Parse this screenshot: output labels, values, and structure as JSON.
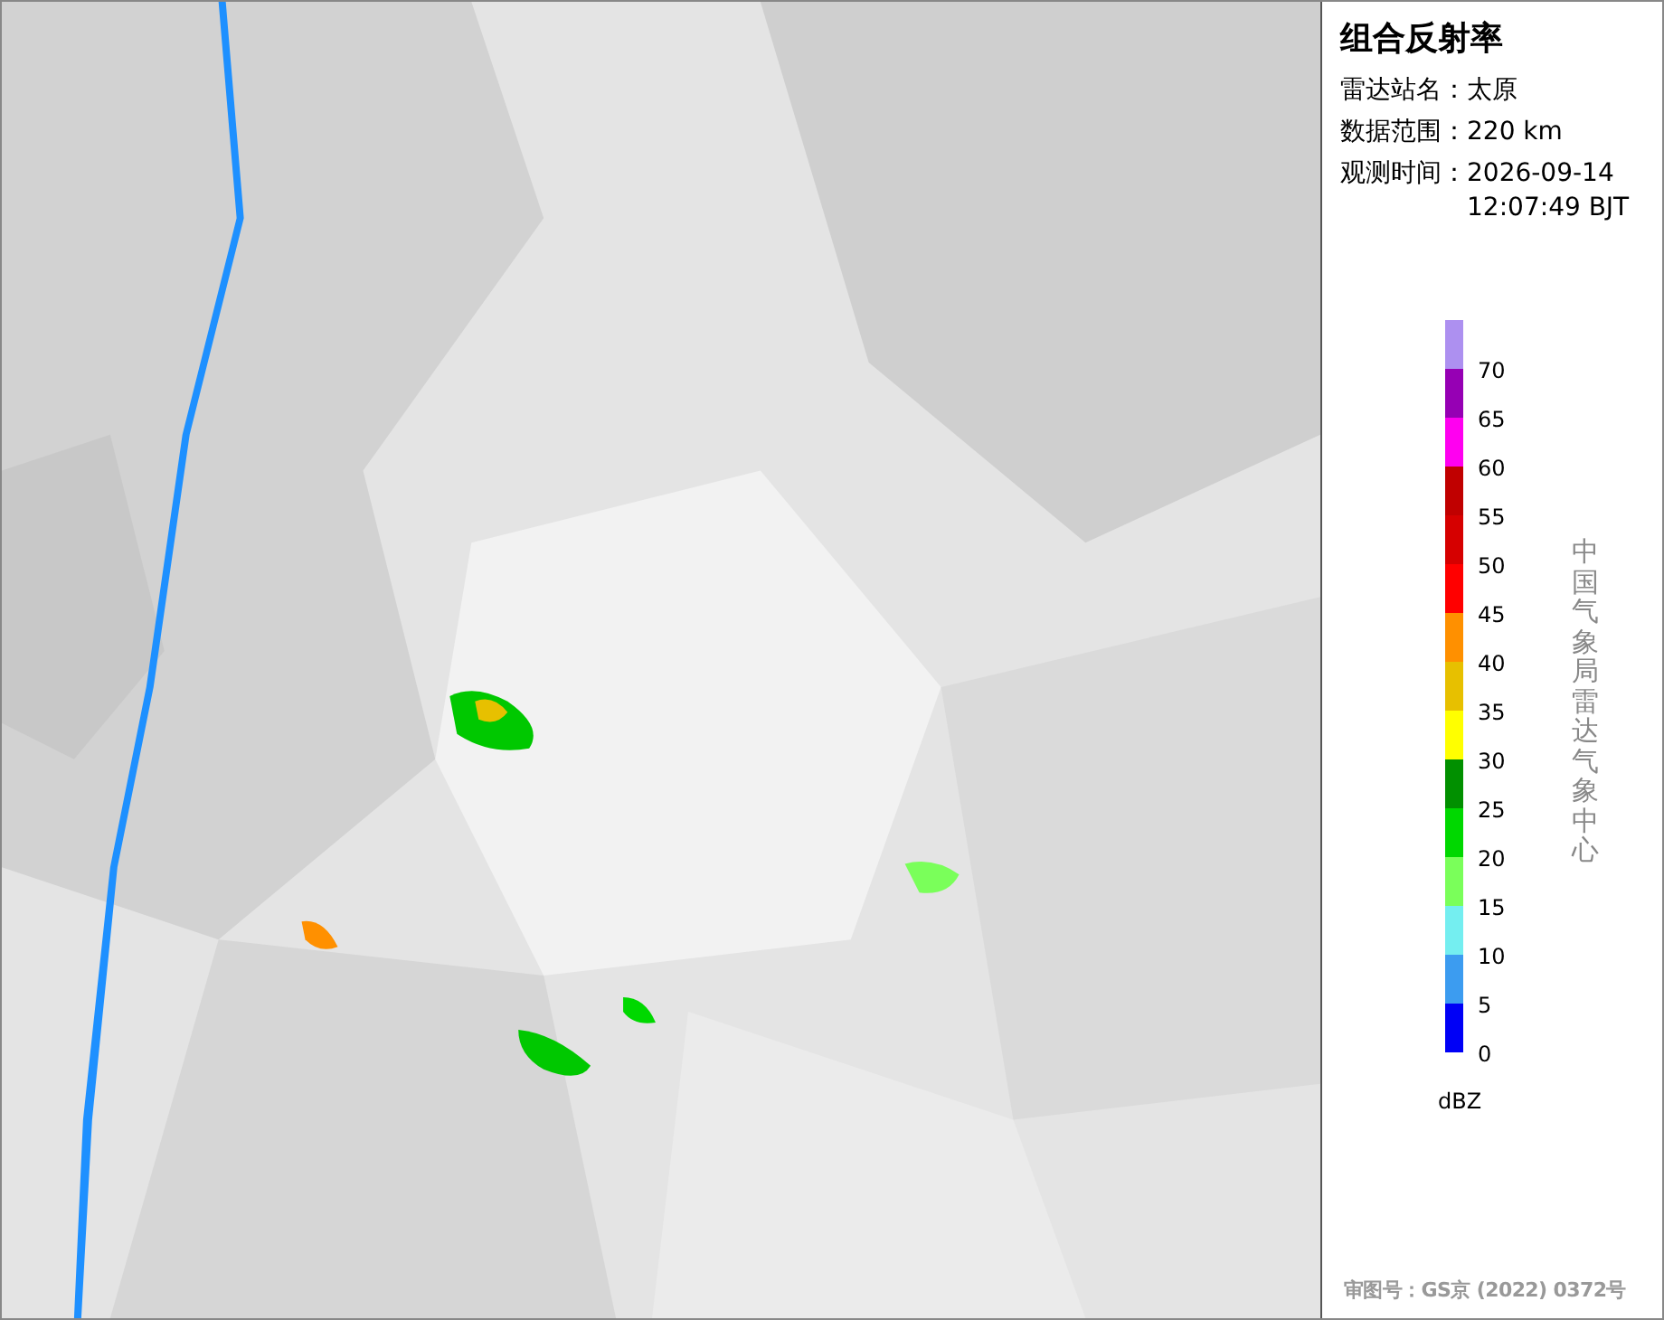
{
  "panel": {
    "title": "组合反射率",
    "info": [
      {
        "label": "雷达站名：",
        "value": "太原"
      },
      {
        "label": "数据范围：",
        "value": "220 km"
      },
      {
        "label": "观测时间：",
        "value": "2026-09-14 12:07:49 BJT"
      }
    ],
    "legend": {
      "items": [
        {
          "value": "70",
          "color": "#ad90f0"
        },
        {
          "value": "65",
          "color": "#9600b4"
        },
        {
          "value": "60",
          "color": "#ff00f0"
        },
        {
          "value": "55",
          "color": "#c00000"
        },
        {
          "value": "50",
          "color": "#d60000"
        },
        {
          "value": "45",
          "color": "#ff0000"
        },
        {
          "value": "40",
          "color": "#ff9000"
        },
        {
          "value": "35",
          "color": "#e7c000"
        },
        {
          "value": "30",
          "color": "#ffff00"
        },
        {
          "value": "25",
          "color": "#019000"
        },
        {
          "value": "20",
          "color": "#00d800"
        },
        {
          "value": "15",
          "color": "#7aff5a"
        },
        {
          "value": "10",
          "color": "#74eef0"
        },
        {
          "value": "5",
          "color": "#3c9cf0"
        },
        {
          "value": "0",
          "color": "#0000f6"
        }
      ],
      "unit": "dBZ"
    },
    "credit": "中国气象局雷达气象中心",
    "footer": "审图号：GS京 (2022) 0372号"
  }
}
